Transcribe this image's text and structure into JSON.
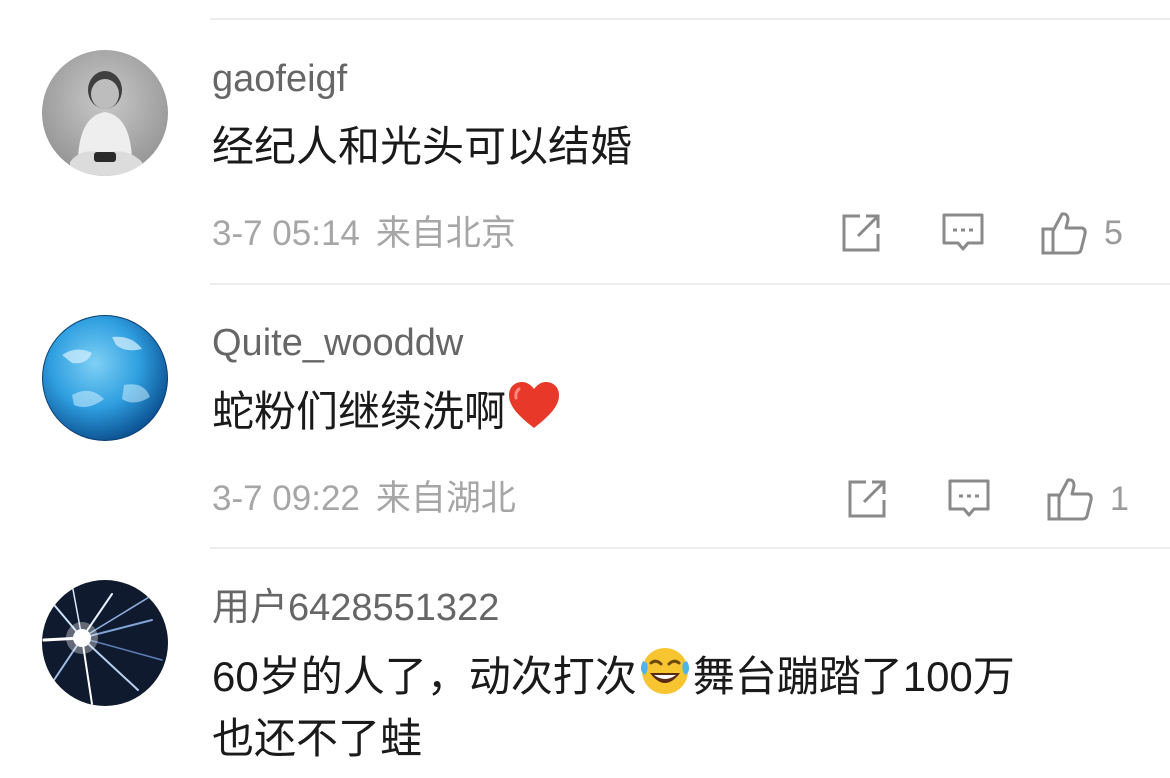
{
  "comments": [
    {
      "username": "gaofeigf",
      "text": "经纪人和光头可以结婚",
      "date": "3-7 05:14",
      "location": "来自北京",
      "likes": "5",
      "avatar_icon": "baby-photo-avatar"
    },
    {
      "username": "Quite_wooddw",
      "text_before_emoji": "蛇粉们继续洗啊",
      "emoji": "red-heart-icon",
      "date": "3-7 09:22",
      "location": "来自湖北",
      "likes": "1",
      "avatar_icon": "blue-planet-avatar"
    },
    {
      "username": "用户6428551322",
      "text_line1_before_emoji": "60岁的人了，动次打次",
      "emoji": "laughing-crying-face-icon",
      "text_line1_after_emoji": "舞台蹦踏了100万",
      "text_line2": "也还不了蛙",
      "avatar_icon": "light-burst-avatar"
    }
  ],
  "icons": {
    "repost": "share-square-icon",
    "reply": "comment-bubble-icon",
    "like": "thumbs-up-icon"
  },
  "colors": {
    "username": "#666666",
    "text": "#1a1a1a",
    "meta": "#a6a6a6",
    "divider": "#ececec",
    "heart": "#e8382a"
  }
}
